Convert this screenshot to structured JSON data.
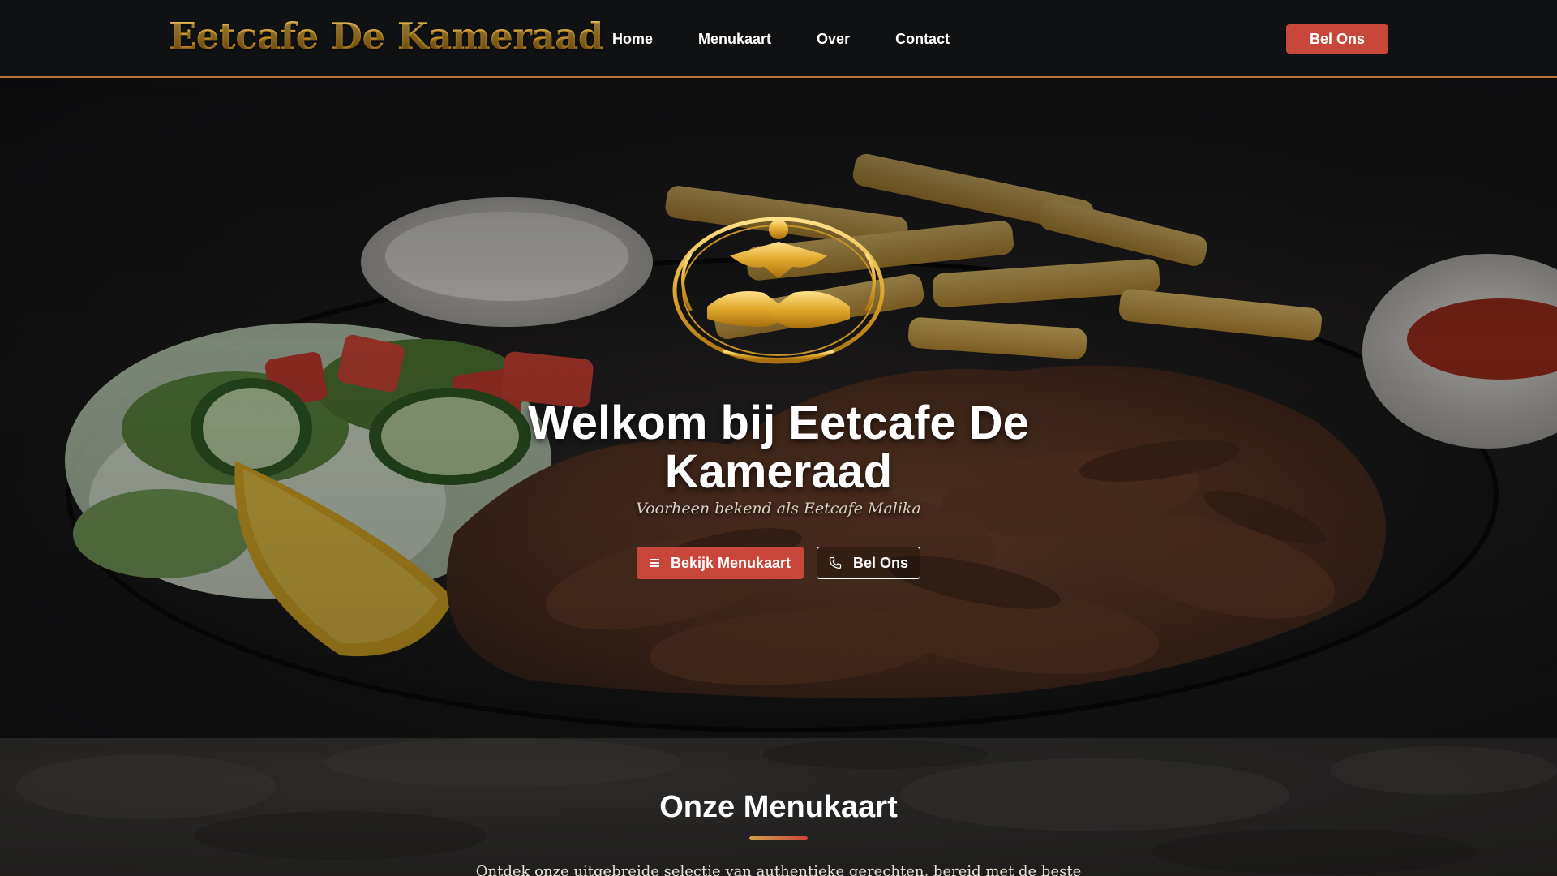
{
  "header": {
    "brand": "Eetcafe De Kameraad",
    "nav": [
      "Home",
      "Menukaart",
      "Over",
      "Contact"
    ],
    "cta_label": "Bel Ons"
  },
  "hero": {
    "title": "Welkom bij Eetcafe De Kameraad",
    "subtitle": "Voorheen bekend als Eetcafe Malika",
    "primary_button": "Bekijk Menukaart",
    "secondary_button": "Bel Ons"
  },
  "menu_section": {
    "title": "Onze Menukaart",
    "intro": "Ontdek onze uitgebreide selectie van authentieke gerechten, bereid met de beste"
  },
  "colors": {
    "accent": "#c9473a",
    "gold": "#d9a431",
    "header_bg": "#0f1113",
    "header_border": "#b8733d"
  },
  "icons": {
    "primary_button_icon": "menu-lines-icon",
    "secondary_button_icon": "phone-icon",
    "emblem": "handshake-emblem"
  }
}
